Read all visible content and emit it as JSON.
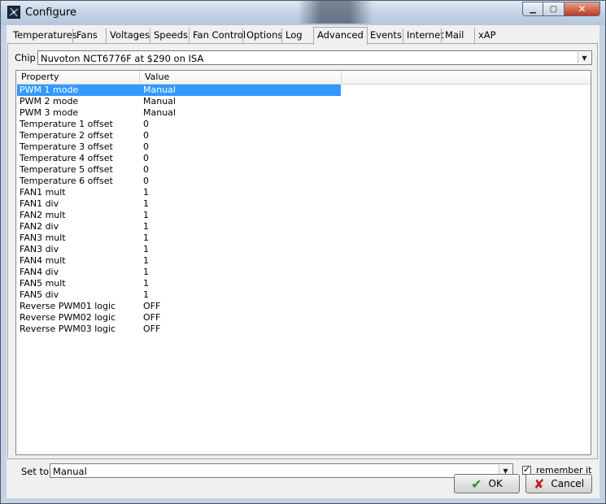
{
  "window": {
    "title": "Configure"
  },
  "tabs": [
    "Temperatures",
    "Fans",
    "Voltages",
    "Speeds",
    "Fan Control",
    "Options",
    "Log",
    "Advanced",
    "Events",
    "Internet",
    "Mail",
    "xAP"
  ],
  "active_tab": "Advanced",
  "chip": {
    "label": "Chip",
    "value": "Nuvoton NCT6776F at $290 on ISA"
  },
  "table": {
    "columns": [
      "Property",
      "Value"
    ],
    "rows": [
      {
        "property": "PWM 1 mode",
        "value": "Manual"
      },
      {
        "property": "PWM 2 mode",
        "value": "Manual"
      },
      {
        "property": "PWM 3 mode",
        "value": "Manual"
      },
      {
        "property": "Temperature 1 offset",
        "value": "0"
      },
      {
        "property": "Temperature 2 offset",
        "value": "0"
      },
      {
        "property": "Temperature 3 offset",
        "value": "0"
      },
      {
        "property": "Temperature 4 offset",
        "value": "0"
      },
      {
        "property": "Temperature 5 offset",
        "value": "0"
      },
      {
        "property": "Temperature 6 offset",
        "value": "0"
      },
      {
        "property": "FAN1 mult",
        "value": "1"
      },
      {
        "property": "FAN1 div",
        "value": "1"
      },
      {
        "property": "FAN2 mult",
        "value": "1"
      },
      {
        "property": "FAN2 div",
        "value": "1"
      },
      {
        "property": "FAN3 mult",
        "value": "1"
      },
      {
        "property": "FAN3 div",
        "value": "1"
      },
      {
        "property": "FAN4 mult",
        "value": "1"
      },
      {
        "property": "FAN4 div",
        "value": "1"
      },
      {
        "property": "FAN5 mult",
        "value": "1"
      },
      {
        "property": "FAN5 div",
        "value": "1"
      },
      {
        "property": "Reverse PWM01 logic",
        "value": "OFF"
      },
      {
        "property": "Reverse PWM02 logic",
        "value": "OFF"
      },
      {
        "property": "Reverse PWM03 logic",
        "value": "OFF"
      }
    ],
    "selected_index": 0
  },
  "set_to": {
    "label": "Set to",
    "value": "Manual"
  },
  "remember": {
    "label": "remember it",
    "checked": true
  },
  "buttons": {
    "ok": "OK",
    "cancel": "Cancel"
  },
  "colors": {
    "selection": "#3399ff",
    "ok_check": "#1f9a1f",
    "cancel_x": "#c41a1a"
  }
}
